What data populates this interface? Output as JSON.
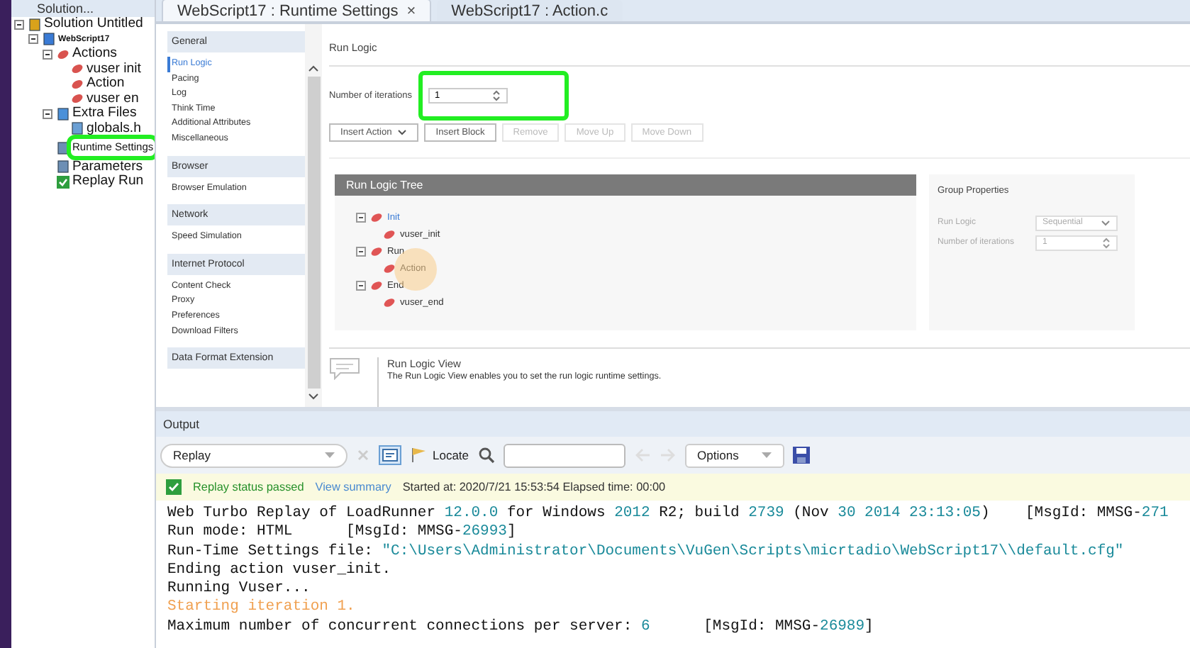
{
  "solution_explorer": {
    "title": "Solution...",
    "tree": [
      {
        "label": "Solution Untitled",
        "kind": "solution",
        "expanded": true,
        "children": [
          {
            "label": "WebScript17",
            "kind": "script",
            "expanded": true,
            "children": [
              {
                "label": "Actions",
                "kind": "actions",
                "expanded": true,
                "children": [
                  {
                    "label": "vuser  init",
                    "kind": "action"
                  },
                  {
                    "label": "Action",
                    "kind": "action"
                  },
                  {
                    "label": "vuser  en",
                    "kind": "action"
                  }
                ]
              },
              {
                "label": "Extra Files",
                "kind": "files",
                "expanded": true,
                "children": [
                  {
                    "label": "globals.h",
                    "kind": "file"
                  }
                ]
              },
              {
                "label": "Runtime Settings",
                "kind": "settings",
                "highlighted": true
              },
              {
                "label": "Parameters",
                "kind": "parameters"
              },
              {
                "label": "Replay Run",
                "kind": "replay"
              }
            ]
          }
        ]
      }
    ]
  },
  "tabs": [
    {
      "label": "WebScript17 : Runtime Settings",
      "selected": true,
      "close": "×"
    },
    {
      "label": "WebScript17 : Action.c",
      "selected": false
    }
  ],
  "settings_nav": [
    {
      "header": "General",
      "items": [
        {
          "label": "Run Logic",
          "selected": true
        },
        {
          "label": "Pacing",
          "selected": false
        },
        {
          "label": "Log",
          "selected": false
        },
        {
          "label": "Think Time",
          "selected": false
        },
        {
          "label": "Additional Attributes",
          "selected": false
        },
        {
          "label": "Miscellaneous",
          "selected": false
        }
      ]
    },
    {
      "header": "Browser",
      "items": [
        {
          "label": "Browser Emulation",
          "selected": false
        }
      ]
    },
    {
      "header": "Network",
      "items": [
        {
          "label": "Speed Simulation",
          "selected": false
        }
      ]
    },
    {
      "header": "Internet Protocol",
      "items": [
        {
          "label": "Content Check",
          "selected": false
        },
        {
          "label": "Proxy",
          "selected": false
        },
        {
          "label": "Preferences",
          "selected": false
        },
        {
          "label": "Download Filters",
          "selected": false
        }
      ]
    },
    {
      "header": "Data Format Extension"
    }
  ],
  "run_logic": {
    "title": "Run Logic",
    "iterations_label": "Number of iterations",
    "iterations_value": "1",
    "iterations_highlighted": true,
    "buttons": [
      {
        "label": "Insert Action",
        "dropdown": true,
        "disabled": false
      },
      {
        "label": "Insert Block",
        "disabled": false
      },
      {
        "label": "Remove",
        "disabled": true
      },
      {
        "label": "Move Up",
        "disabled": true
      },
      {
        "label": "Move Down",
        "disabled": true
      }
    ],
    "tree_title": "Run Logic Tree",
    "tree": [
      {
        "label": "Init",
        "selected": true,
        "children": [
          {
            "label": "vuser_init",
            "selected": false
          }
        ]
      },
      {
        "label": "Run",
        "selected": false,
        "children": [
          {
            "label": "Action",
            "selected": false
          }
        ]
      },
      {
        "label": "End",
        "selected": false,
        "children": [
          {
            "label": "vuser_end",
            "selected": false
          }
        ]
      }
    ],
    "group_properties": {
      "title": "Group Properties",
      "run_logic_label": "Run Logic",
      "run_logic_value": "Sequential",
      "iterations_label": "Number of iterations",
      "iterations_value": "1"
    },
    "info_title": "Run Logic View",
    "info_text": "The Run Logic View enables you to set the run logic runtime settings."
  },
  "output": {
    "title": "Output",
    "source": "Replay",
    "locate": "Locate",
    "options": "Options",
    "status": "Replay status passed",
    "view_summary": "View summary",
    "started": "Started at: 2020/7/21 15:53:54 Elapsed time: 00:00",
    "log": [
      [
        {
          "text": "Web Turbo Replay of LoadRunner ",
          "kind": "plain"
        },
        {
          "text": "12.0.0",
          "kind": "number"
        },
        {
          "text": " for Windows ",
          "kind": "plain"
        },
        {
          "text": "2012",
          "kind": "number"
        },
        {
          "text": " R2; build ",
          "kind": "plain"
        },
        {
          "text": "2739",
          "kind": "number"
        },
        {
          "text": " (Nov ",
          "kind": "plain"
        },
        {
          "text": "30 2014 23:13:05",
          "kind": "number"
        },
        {
          "text": ")    [MsgId: MMSG-",
          "kind": "plain"
        },
        {
          "text": "271",
          "kind": "number"
        }
      ],
      [
        {
          "text": "Run mode: HTML      [MsgId: MMSG-",
          "kind": "plain"
        },
        {
          "text": "26993",
          "kind": "number"
        },
        {
          "text": "]",
          "kind": "plain"
        }
      ],
      [
        {
          "text": "Run-Time Settings file: ",
          "kind": "plain"
        },
        {
          "text": "\"C:\\Users\\Administrator\\Documents\\VuGen\\Scripts\\micrtadio\\WebScript17\\\\default.cfg\"",
          "kind": "string"
        }
      ],
      [
        {
          "text": "Ending action vuser_init.",
          "kind": "plain"
        }
      ],
      [
        {
          "text": "Running Vuser...",
          "kind": "plain"
        }
      ],
      [
        {
          "text": "Starting iteration 1.",
          "kind": "notice"
        }
      ],
      [
        {
          "text": "Maximum number of concurrent connections per server: ",
          "kind": "plain"
        },
        {
          "text": "6",
          "kind": "number"
        },
        {
          "text": "      [MsgId: MMSG-",
          "kind": "plain"
        },
        {
          "text": "26989",
          "kind": "number"
        },
        {
          "text": "]",
          "kind": "plain"
        }
      ]
    ]
  }
}
